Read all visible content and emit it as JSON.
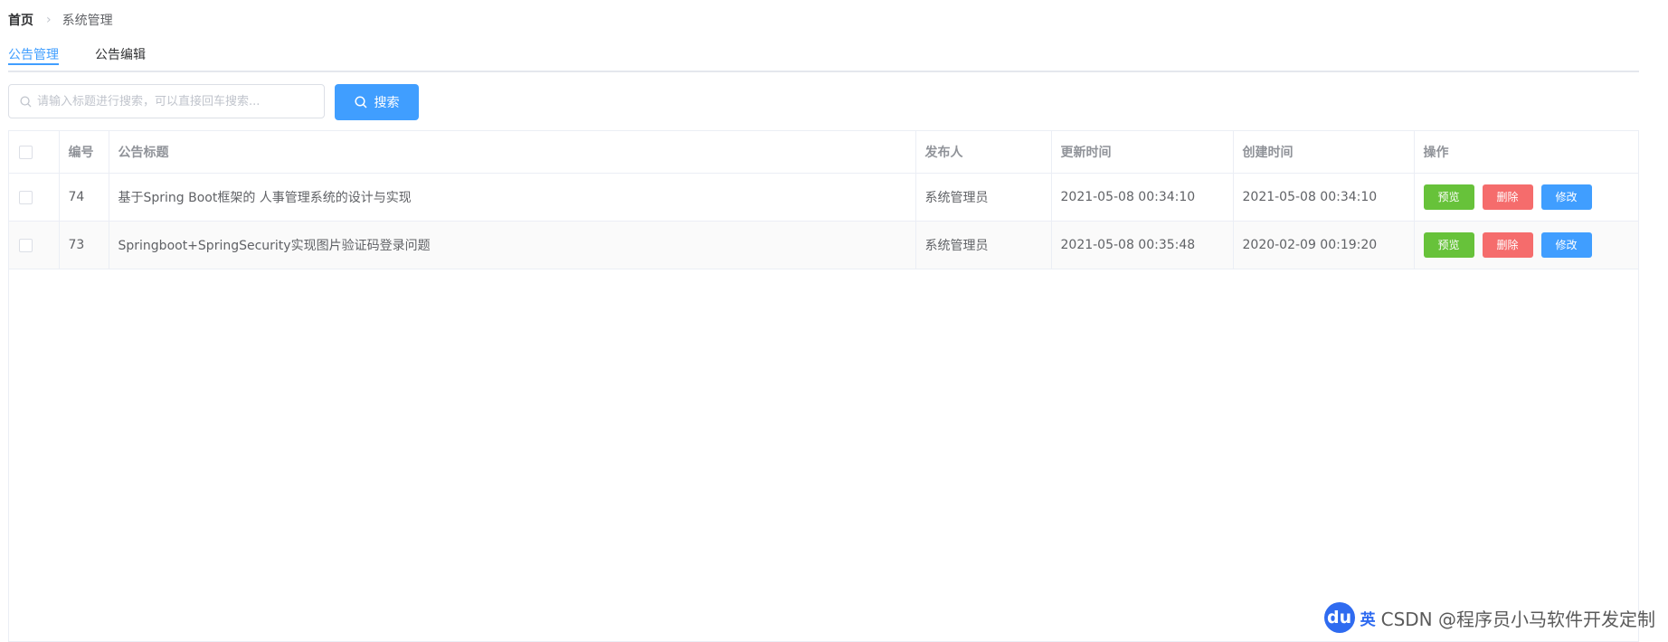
{
  "breadcrumb": {
    "home": "首页",
    "current": "系统管理"
  },
  "tabs": [
    {
      "label": "公告管理"
    },
    {
      "label": "公告编辑"
    }
  ],
  "search": {
    "placeholder": "请输入标题进行搜索，可以直接回车搜索...",
    "value": "",
    "button_label": "搜索"
  },
  "table": {
    "columns": {
      "id": "编号",
      "title": "公告标题",
      "publisher": "发布人",
      "updated": "更新时间",
      "created": "创建时间",
      "actions": "操作"
    },
    "rows": [
      {
        "id": "74",
        "title": "基于Spring Boot框架的 人事管理系统的设计与实现",
        "publisher": "系统管理员",
        "updated": "2021-05-08 00:34:10",
        "created": "2021-05-08 00:34:10"
      },
      {
        "id": "73",
        "title": "Springboot+SpringSecurity实现图片验证码登录问题",
        "publisher": "系统管理员",
        "updated": "2021-05-08 00:35:48",
        "created": "2020-02-09 00:19:20"
      }
    ],
    "actions": {
      "preview": "预览",
      "delete": "删除",
      "edit": "修改"
    }
  },
  "watermark": {
    "logo": "du",
    "ime": "英",
    "text": "CSDN @程序员小马软件开发定制"
  },
  "colors": {
    "primary": "#409eff",
    "success": "#67c23a",
    "danger": "#f56c6c"
  }
}
